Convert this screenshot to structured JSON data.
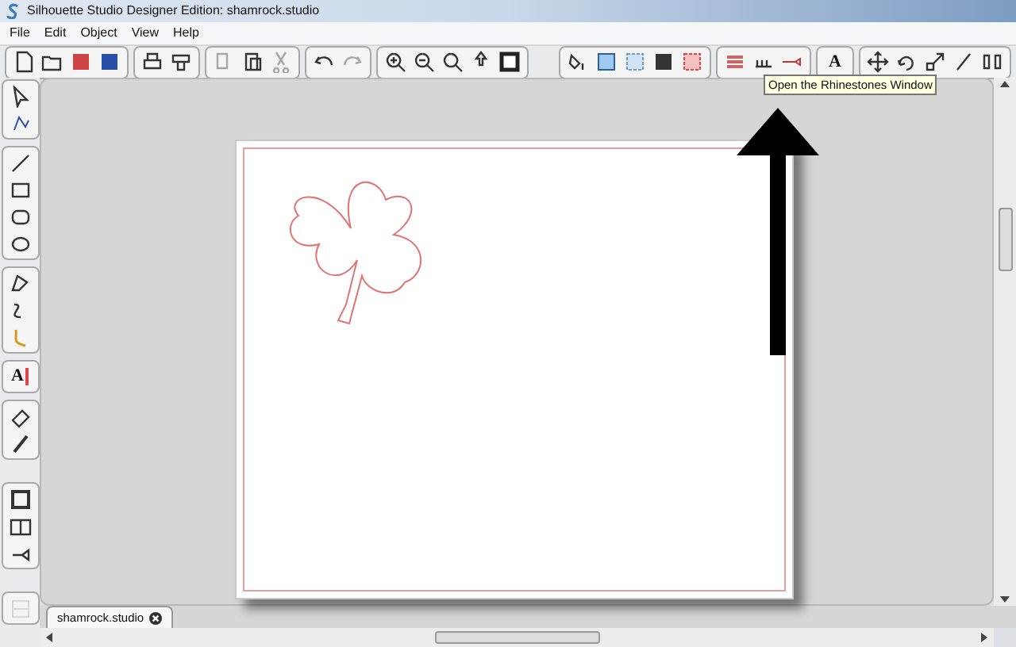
{
  "window": {
    "title": "Silhouette Studio Designer Edition: shamrock.studio"
  },
  "menu": [
    "File",
    "Edit",
    "Object",
    "View",
    "Help"
  ],
  "tooltip": "Open the Rhinestones Window",
  "text_button": "A",
  "text_tool": "A",
  "tabs": [
    {
      "label": "shamrock.studio",
      "selected": true
    }
  ]
}
